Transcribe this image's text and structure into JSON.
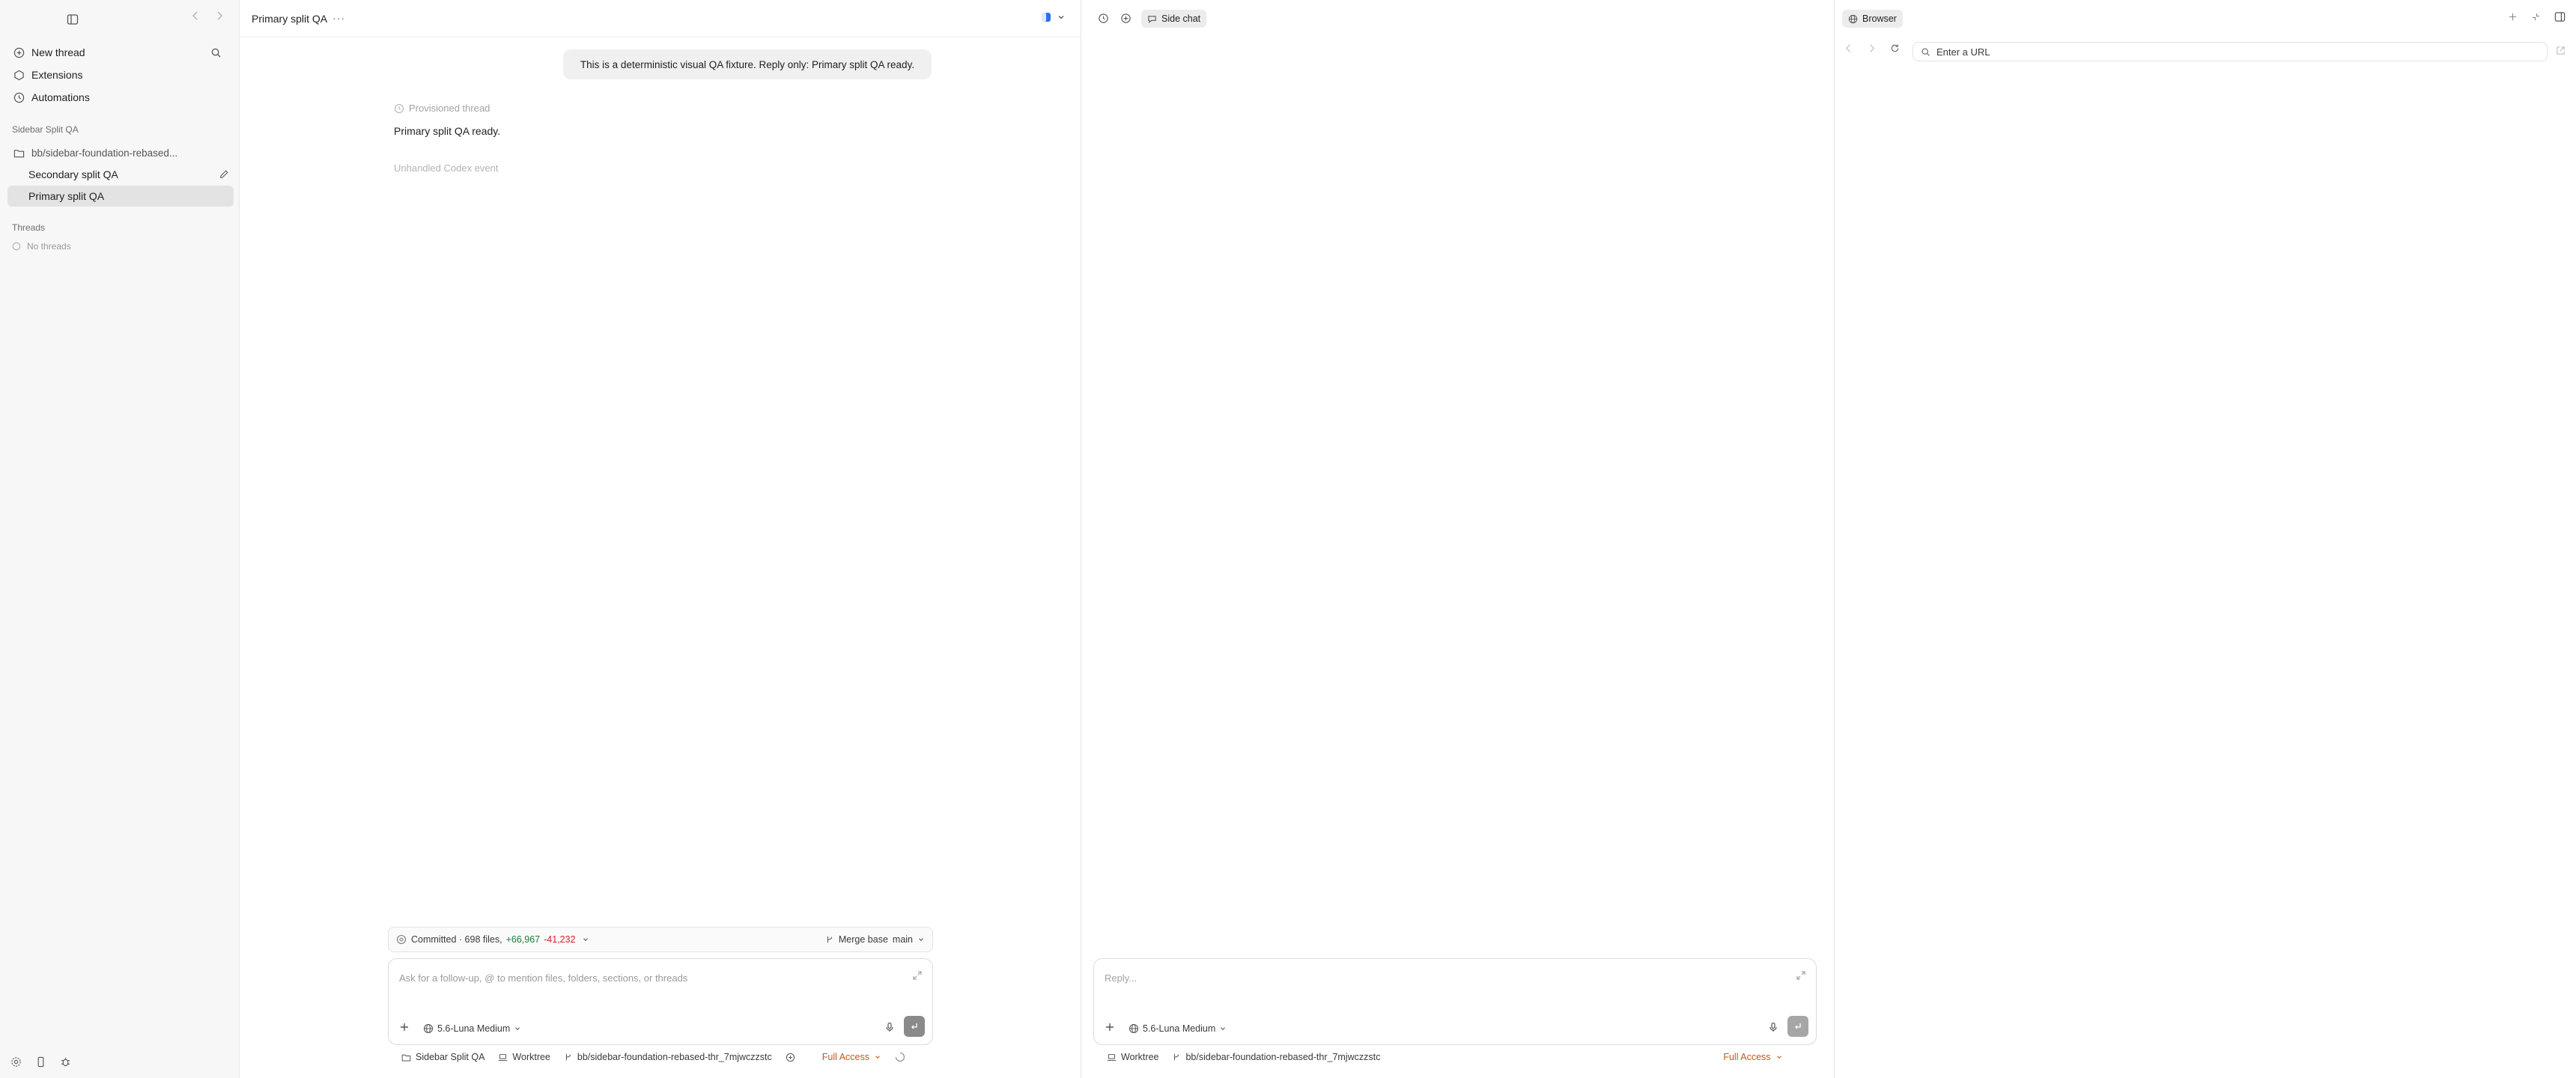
{
  "sidebar": {
    "nav": [
      {
        "label": "New thread",
        "icon": "compose-icon"
      },
      {
        "label": "Extensions",
        "icon": "extensions-icon"
      },
      {
        "label": "Automations",
        "icon": "clock-icon"
      }
    ],
    "project_section": "Sidebar Split QA",
    "branch": "bb/sidebar-foundation-rebased...",
    "threads_in_project": [
      {
        "label": "Secondary split QA",
        "active": false
      },
      {
        "label": "Primary split QA",
        "active": true
      }
    ],
    "threads_section": "Threads",
    "no_threads": "No threads"
  },
  "main": {
    "title": "Primary split QA",
    "more": "···",
    "user_message": "This is a deterministic visual QA fixture. Reply only: Primary split QA ready.",
    "provisioned": "Provisioned thread",
    "reply": "Primary split QA ready.",
    "unhandled": "Unhandled Codex event",
    "commit": {
      "prefix": "Committed · 698 files,",
      "added": "+66,967",
      "removed": "-41,232",
      "merge_base_label": "Merge base",
      "merge_base_value": "main"
    },
    "composer_placeholder": "Ask for a follow-up, @ to mention files, folders, sections, or threads",
    "model": "5.6-Luna Medium",
    "footer": {
      "project": "Sidebar Split QA",
      "worktree": "Worktree",
      "branch": "bb/sidebar-foundation-rebased-thr_7mjwczzstc",
      "access": "Full Access"
    }
  },
  "side_chat": {
    "tab_label": "Side chat",
    "composer_placeholder": "Reply...",
    "model": "5.6-Luna Medium",
    "footer": {
      "worktree": "Worktree",
      "branch": "bb/sidebar-foundation-rebased-thr_7mjwczzstc",
      "access": "Full Access"
    }
  },
  "browser": {
    "tab_label": "Browser",
    "url_placeholder": "Enter a URL"
  },
  "colors": {
    "accent_orange": "#c15a1a",
    "diff_green": "#1a7f37",
    "diff_red": "#cf222e",
    "active_bg": "#e3e3e3"
  }
}
